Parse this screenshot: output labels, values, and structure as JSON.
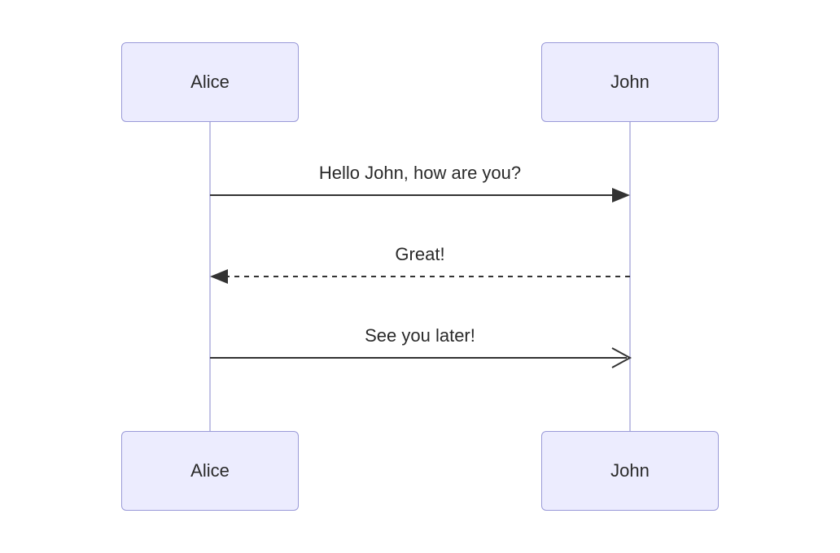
{
  "actors": {
    "left": "Alice",
    "right": "John"
  },
  "messages": {
    "m1": "Hello John, how are you?",
    "m2": "Great!",
    "m3": "See you later!"
  },
  "chart_data": {
    "type": "sequence-diagram",
    "participants": [
      "Alice",
      "John"
    ],
    "interactions": [
      {
        "from": "Alice",
        "to": "John",
        "text": "Hello John, how are you?",
        "style": "solid",
        "arrow": "filled"
      },
      {
        "from": "John",
        "to": "Alice",
        "text": "Great!",
        "style": "dashed",
        "arrow": "filled"
      },
      {
        "from": "Alice",
        "to": "John",
        "text": "See you later!",
        "style": "solid",
        "arrow": "open"
      }
    ]
  }
}
